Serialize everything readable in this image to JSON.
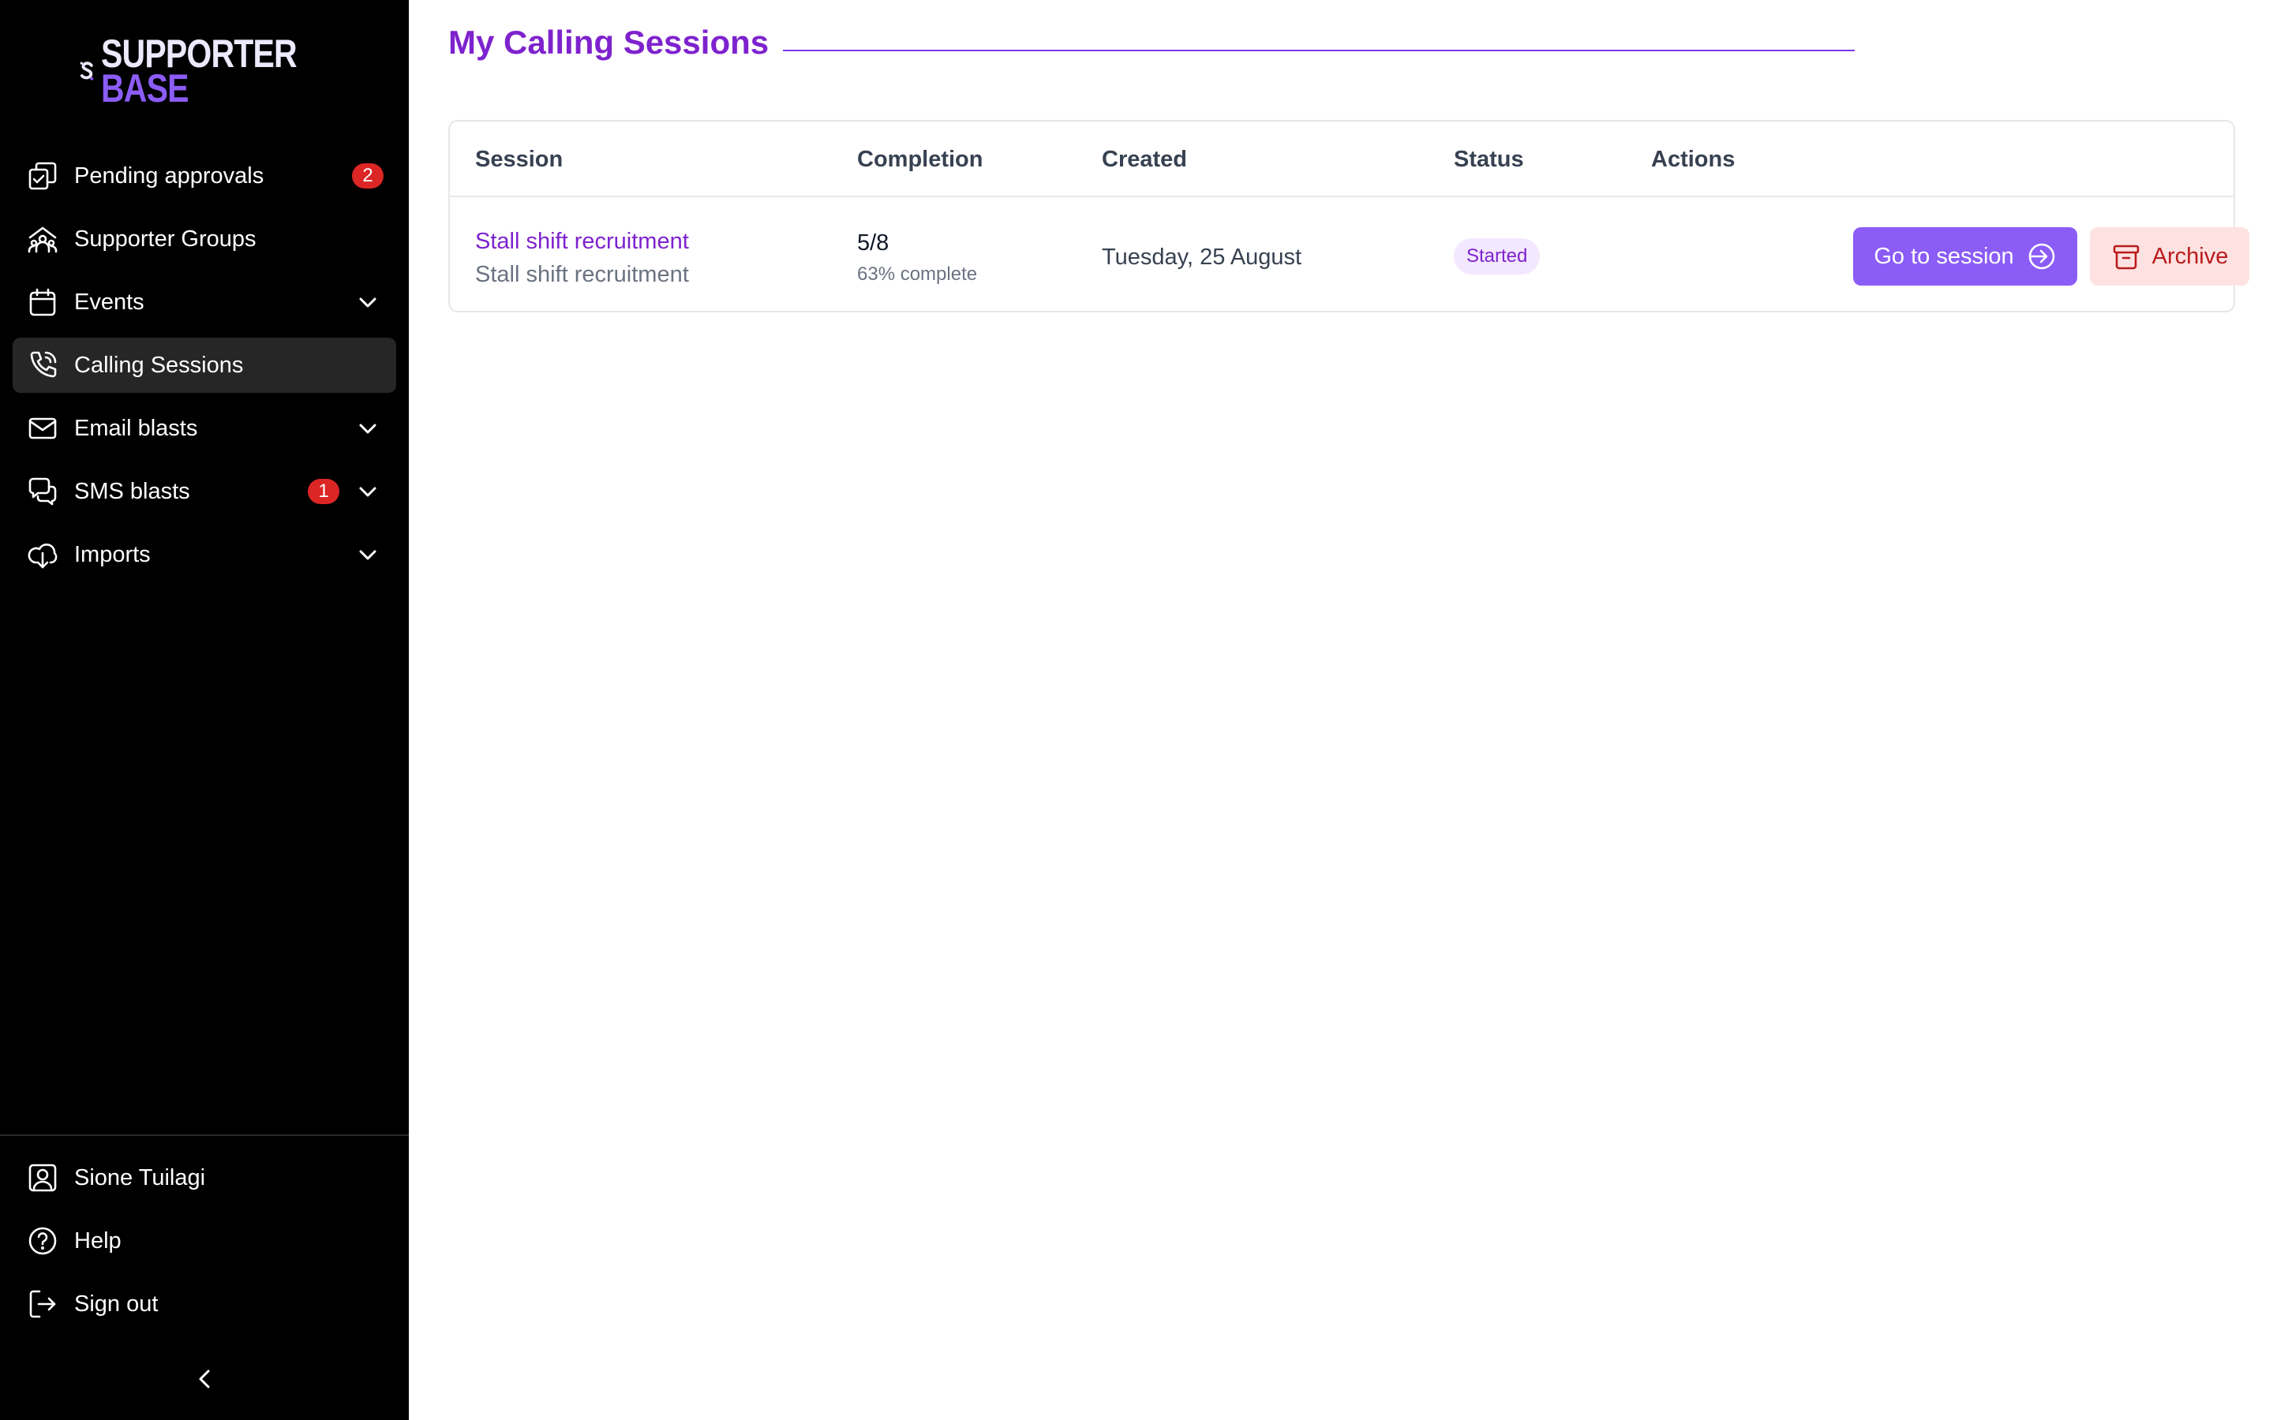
{
  "brand": {
    "word1": "SUPPORTER",
    "word2": "BASE"
  },
  "sidebar": {
    "items": [
      {
        "label": "Pending approvals",
        "icon": "approvals-icon",
        "badge": "2",
        "expandable": false
      },
      {
        "label": "Supporter Groups",
        "icon": "groups-icon",
        "expandable": false
      },
      {
        "label": "Events",
        "icon": "calendar-icon",
        "expandable": true
      },
      {
        "label": "Calling Sessions",
        "icon": "phone-icon",
        "active": true,
        "expandable": false
      },
      {
        "label": "Email blasts",
        "icon": "mail-icon",
        "expandable": true
      },
      {
        "label": "SMS blasts",
        "icon": "chat-icon",
        "badge": "1",
        "expandable": true
      },
      {
        "label": "Imports",
        "icon": "cloud-download-icon",
        "expandable": true
      }
    ],
    "bottom": [
      {
        "label": "Sione Tuilagi",
        "icon": "user-icon"
      },
      {
        "label": "Help",
        "icon": "help-icon"
      },
      {
        "label": "Sign out",
        "icon": "sign-out-icon"
      }
    ]
  },
  "main": {
    "title": "My Calling Sessions",
    "table": {
      "headers": [
        "Session",
        "Completion",
        "Created",
        "Status",
        "Actions"
      ],
      "rows": [
        {
          "session_name": "Stall shift recruitment",
          "session_description": "Stall shift recruitment",
          "completion": "5/8",
          "completion_percent": "63% complete",
          "created": "Tuesday, 25 August",
          "status": "Started",
          "actions": {
            "go": "Go to session",
            "archive": "Archive"
          }
        }
      ]
    }
  },
  "colors": {
    "accent": "#7e22ce",
    "button": "#8b5cf6",
    "danger_bg": "#fee2e2",
    "danger_text": "#b91c1c",
    "badge": "#dc2626",
    "sidebar_bg": "#000000"
  }
}
